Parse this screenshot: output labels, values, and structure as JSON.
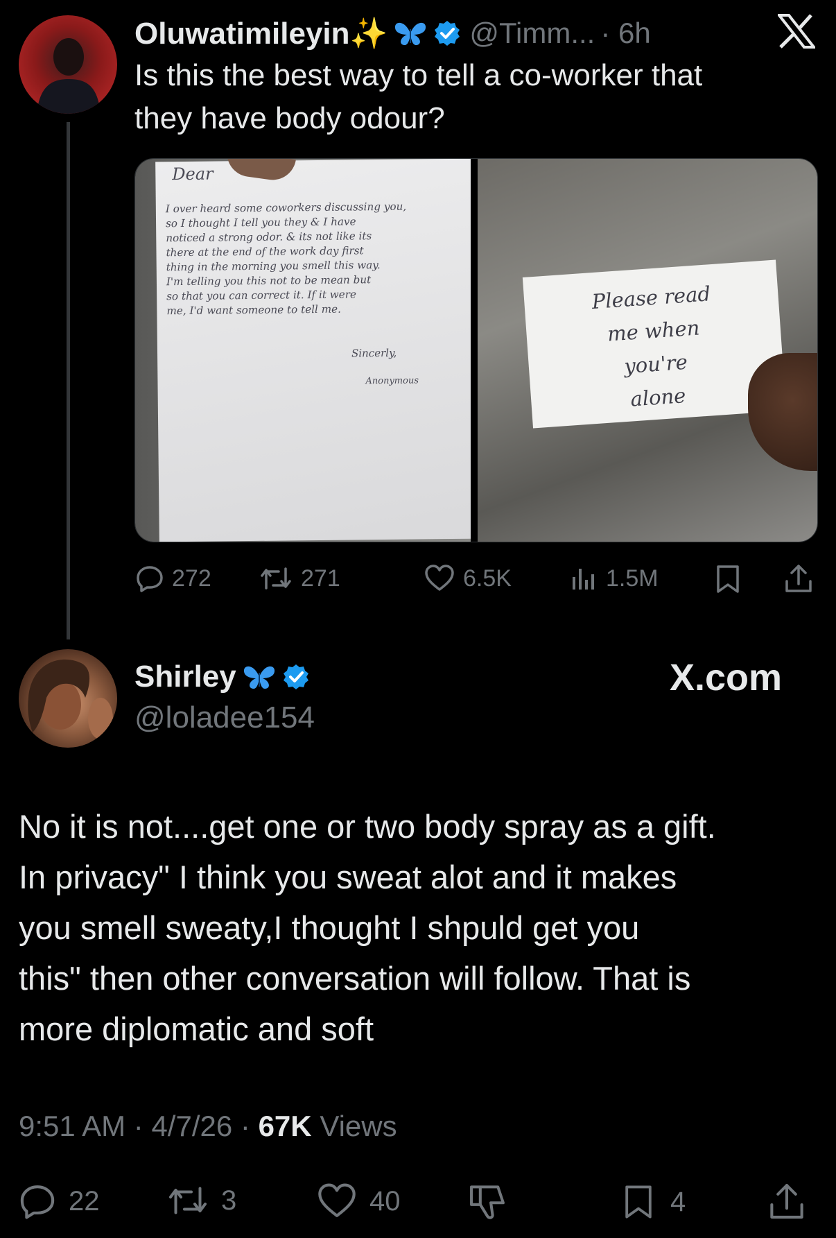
{
  "original_tweet": {
    "display_name": "Oluwatimileyin✨",
    "handle": "@Timm...",
    "time": "· 6h",
    "text_line1": "Is this the best way to tell a co-worker that",
    "text_line2": "they have body odour?",
    "media": {
      "note1": {
        "greeting": "Dear",
        "lines": [
          "I over heard some coworkers discussing you,",
          "so I thought I tell you they & I have",
          "noticed a strong odor. & its not like its",
          "there at the end of the work day first",
          "thing in the morning you smell this way.",
          "I'm telling you this not to be mean but",
          "so that you can correct it. If it were",
          "me, I'd want someone to tell me."
        ],
        "signoff": "Sincerly,",
        "signature": "Anonymous"
      },
      "note2": {
        "lines": [
          "Please read",
          "me when",
          "you're",
          "alone"
        ]
      }
    },
    "actions": {
      "replies": "272",
      "reposts": "271",
      "likes": "6.5K",
      "views": "1.5M"
    }
  },
  "reply_tweet": {
    "display_name": "Shirley",
    "handle": "@loladee154",
    "watermark": "X.com",
    "text_lines": [
      "No it is not....get one or two body spray as a gift.",
      "In privacy\" I think you sweat alot and it makes",
      "you smell sweaty,I thought I shpuld get you",
      "this\" then other conversation will follow. That is",
      "more diplomatic and soft"
    ],
    "time": "9:51 AM",
    "date": "4/7/26",
    "views_count": "67K",
    "views_label": "Views",
    "actions": {
      "replies": "22",
      "reposts": "3",
      "likes": "40",
      "bookmarks": "4"
    }
  },
  "colors": {
    "background": "#000000",
    "text": "#e7e9ea",
    "muted": "#71767b",
    "verified": "#1d9bf0",
    "butterfly": "#3a9bf0"
  },
  "icons": [
    "x-logo-icon",
    "verified-icon",
    "butterfly-icon",
    "sparkles-icon",
    "reply-icon",
    "repost-icon",
    "like-icon",
    "views-icon",
    "bookmark-icon",
    "share-icon",
    "dislike-icon"
  ]
}
